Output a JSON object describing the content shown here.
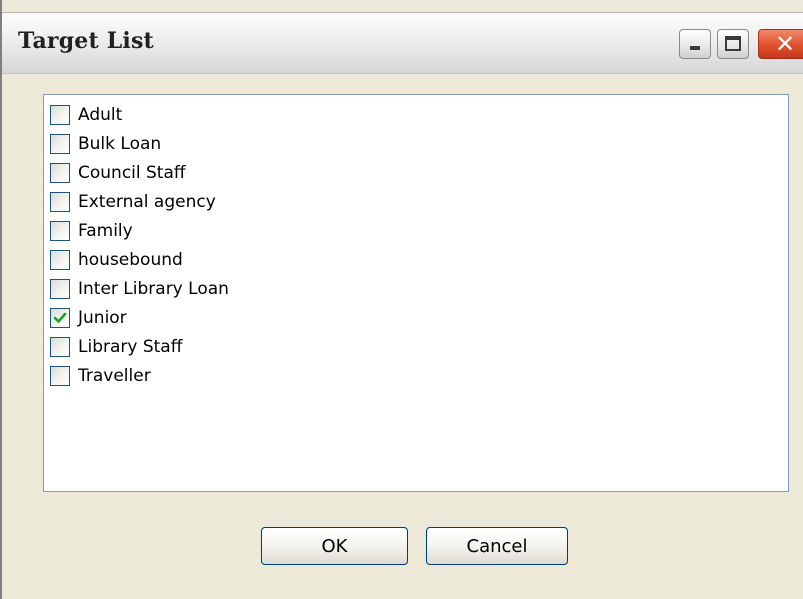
{
  "window": {
    "title": "Target List"
  },
  "titlebar_buttons": {
    "minimize_icon": "minimize-icon",
    "maximize_icon": "maximize-icon",
    "close_icon": "close-icon",
    "close_glyph": "✕"
  },
  "list": {
    "items": [
      {
        "label": "Adult",
        "checked": false
      },
      {
        "label": "Bulk Loan",
        "checked": false
      },
      {
        "label": "Council Staff",
        "checked": false
      },
      {
        "label": "External agency",
        "checked": false
      },
      {
        "label": "Family",
        "checked": false
      },
      {
        "label": "housebound",
        "checked": false
      },
      {
        "label": "Inter Library Loan",
        "checked": false
      },
      {
        "label": "Junior",
        "checked": true
      },
      {
        "label": "Library Staff",
        "checked": false
      },
      {
        "label": "Traveller",
        "checked": false
      }
    ]
  },
  "buttons": {
    "ok_label": "OK",
    "cancel_label": "Cancel"
  },
  "colors": {
    "check_mark": "#21a121",
    "close_button": "#e0502c"
  }
}
